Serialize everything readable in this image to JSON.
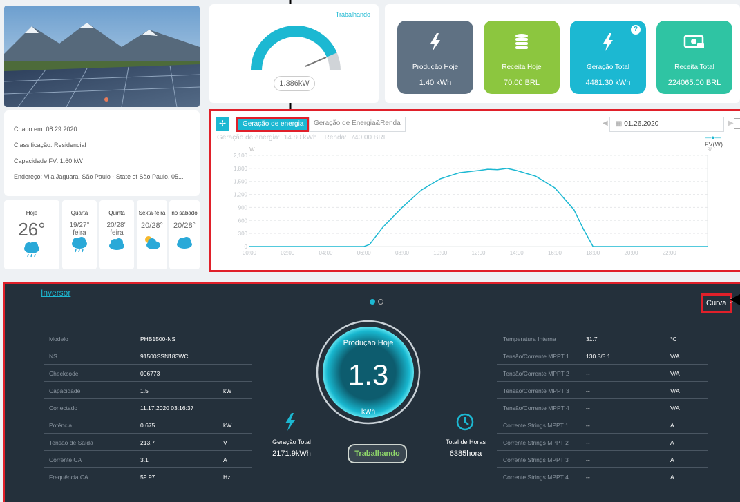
{
  "plant": {
    "created": "Criado em:  08.29.2020",
    "classification": "Classificação:  Residencial",
    "capacity": "Capacidade FV:  1.60 kW",
    "address": "Endereço:  Vila Jaguara, São Paulo - State of São Paulo, 05..."
  },
  "weather": [
    {
      "day": "Hoje",
      "temp": "26°"
    },
    {
      "day": "Quarta",
      "temp": "19/27°",
      "sub": "feira"
    },
    {
      "day": "Quinta",
      "temp": "20/28°",
      "sub": "feira"
    },
    {
      "day": "Sexta-feira",
      "temp": "20/28°"
    },
    {
      "day": "no sábado",
      "temp": "20/28°"
    }
  ],
  "gauge": {
    "status": "Trabalhando",
    "value": "1.386kW",
    "fraction": 0.87
  },
  "kpis": [
    {
      "label": "Produção Hoje",
      "value": "1.40 kWh",
      "color": "#5f7183"
    },
    {
      "label": "Receita Hoje",
      "value": "70.00 BRL",
      "color": "#8cc63f"
    },
    {
      "label": "Geração Total",
      "value": "4481.30 kWh",
      "color": "#1cb8d2"
    },
    {
      "label": "Receita Total",
      "value": "224065.00 BRL",
      "color": "#2fc4a3"
    }
  ],
  "chart_tabs": {
    "energy": "Geração de energia",
    "energy_income": "Geração de Energia&Renda"
  },
  "date": "01.26.2020",
  "chart_summary": "Geração de energia:  14.80 kWh    Renda:  740.00 BRL",
  "chart_data": {
    "type": "area",
    "ylabel": "W",
    "y2label": "%",
    "legend": "FV(W)",
    "ylim": [
      0,
      2100
    ],
    "yticks": [
      "2,100",
      "1,800",
      "1,500",
      "1,200",
      "900",
      "600",
      "300",
      "0"
    ],
    "xticks": [
      "00:00",
      "02:00",
      "04:00",
      "06:00",
      "08:00",
      "10:00",
      "12:00",
      "14:00",
      "16:00",
      "18:00",
      "20:00",
      "22:00"
    ],
    "x_hours": [
      0,
      6.0,
      6.3,
      7.0,
      8.0,
      9.0,
      10.0,
      11.0,
      12.0,
      12.5,
      13.0,
      13.5,
      14.0,
      15.0,
      16.0,
      17.0,
      17.5,
      18.0,
      24
    ],
    "y": [
      0,
      0,
      50,
      450,
      900,
      1300,
      1560,
      1700,
      1750,
      1780,
      1770,
      1800,
      1750,
      1620,
      1350,
      850,
      400,
      0,
      0
    ]
  },
  "inverter": {
    "title": "Inversor",
    "curve_label": "Curva",
    "left_rows": [
      {
        "k": "Modelo",
        "v": "PHB1500-NS",
        "u": ""
      },
      {
        "k": "NS",
        "v": "91500SSN183WC",
        "u": ""
      },
      {
        "k": "Checkcode",
        "v": "006773",
        "u": ""
      },
      {
        "k": "Capacidade",
        "v": "1.5",
        "u": "kW"
      },
      {
        "k": "Conectado",
        "v": "11.17.2020 03:16:37",
        "u": ""
      },
      {
        "k": "Potência",
        "v": "0.675",
        "u": "kW"
      },
      {
        "k": "Tensão de Saída",
        "v": "213.7",
        "u": "V"
      },
      {
        "k": "Corrente CA",
        "v": "3.1",
        "u": "A"
      },
      {
        "k": "Frequência CA",
        "v": "59.97",
        "u": "Hz"
      }
    ],
    "right_rows": [
      {
        "k": "Temperatura Interna",
        "v": "31.7",
        "u": "°C"
      },
      {
        "k": "Tensão/Corrente MPPT 1",
        "v": "130.5/5.1",
        "u": "V/A"
      },
      {
        "k": "Tensão/Corrente MPPT 2",
        "v": "--",
        "u": "V/A"
      },
      {
        "k": "Tensão/Corrente MPPT 3",
        "v": "--",
        "u": "V/A"
      },
      {
        "k": "Tensão/Corrente MPPT 4",
        "v": "--",
        "u": "V/A"
      },
      {
        "k": "Corrente Strings MPPT 1",
        "v": "--",
        "u": "A"
      },
      {
        "k": "Corrente Strings MPPT 2",
        "v": "--",
        "u": "A"
      },
      {
        "k": "Corrente Strings MPPT 3",
        "v": "--",
        "u": "A"
      },
      {
        "k": "Corrente Strings MPPT 4",
        "v": "--",
        "u": "A"
      }
    ],
    "center": {
      "label": "Produção Hoje",
      "value": "1.3",
      "unit": "kWh",
      "status": "Trabalhando"
    },
    "total_gen": {
      "label": "Geração Total",
      "value": "2171.9kWh"
    },
    "total_hours": {
      "label": "Total de Horas",
      "value": "6385hora"
    }
  }
}
